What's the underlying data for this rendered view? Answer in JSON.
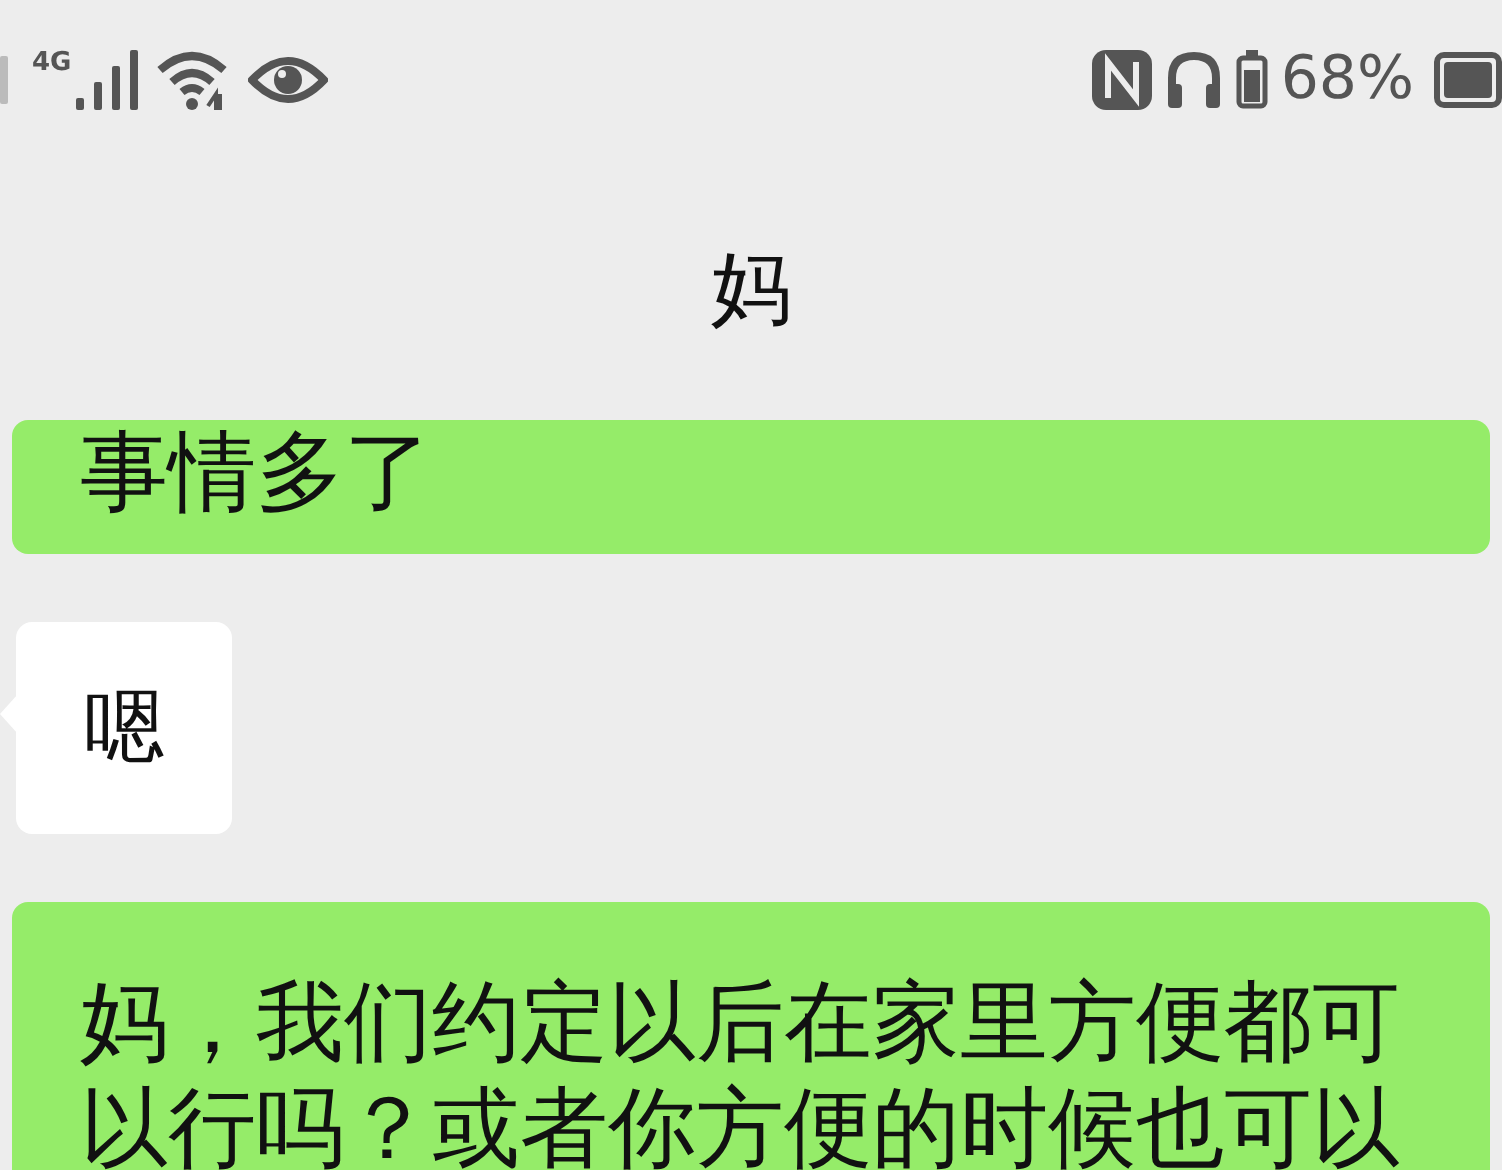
{
  "status_bar": {
    "network": "4G",
    "battery": "68%"
  },
  "header": {
    "title": "妈"
  },
  "messages": [
    {
      "kind": "sent",
      "text": "事情多了"
    },
    {
      "kind": "received",
      "text": "嗯"
    },
    {
      "kind": "sent",
      "text": "妈，我们约定以后在家里方便都可以行吗？或者你方便的时候也可以"
    }
  ]
}
